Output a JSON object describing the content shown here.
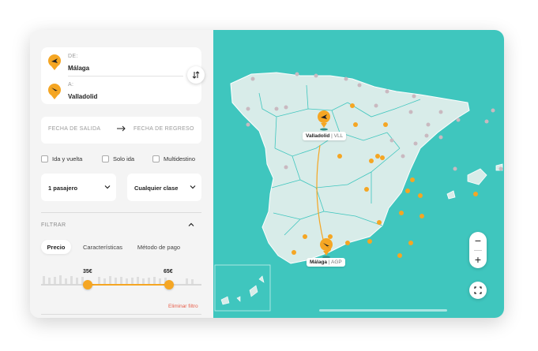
{
  "route": {
    "from_label": "DE:",
    "from_city": "Málaga",
    "to_label": "A:",
    "to_city": "Valladolid"
  },
  "dates": {
    "departure_placeholder": "FECHA DE SALIDA",
    "return_placeholder": "FECHA DE REGRESO"
  },
  "trip_types": [
    "Ida y vuelta",
    "Solo ida",
    "Multidestino"
  ],
  "passengers": {
    "value": "1 pasajero"
  },
  "class": {
    "value": "Cualquier clase"
  },
  "filter": {
    "title": "FILTRAR",
    "tabs": [
      "Precio",
      "Características",
      "Método de pago"
    ],
    "active_tab": "Precio",
    "price_min": "35€",
    "price_max": "65€",
    "range_min_fraction": 0.29,
    "range_max_fraction": 0.8,
    "clear_label": "Eliminar filtro"
  },
  "map": {
    "origin": {
      "city": "Málaga",
      "code": "AGP"
    },
    "destination": {
      "city": "Valladolid",
      "code": "VLL"
    },
    "zoom_in": "+",
    "zoom_out": "−",
    "colors": {
      "sea": "#3fc6be",
      "land": "#d8ece9",
      "accent": "#f5a623",
      "pin_dark": "#2f8f89"
    }
  }
}
